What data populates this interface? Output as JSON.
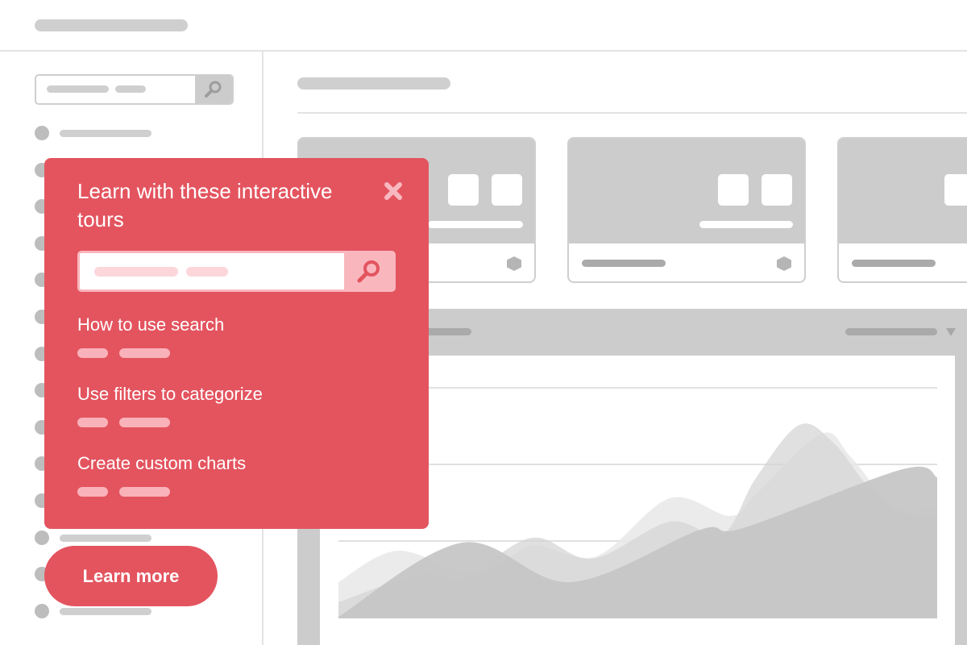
{
  "colors": {
    "accent": "#e3545f",
    "accent_light": "#f9b7bd",
    "placeholder": "#cccccc"
  },
  "popup": {
    "title": "Learn with these interactive tours",
    "close_icon": "close-icon",
    "search_icon": "search-icon",
    "tours": [
      {
        "label": "How to use search"
      },
      {
        "label": "Use filters to categorize"
      },
      {
        "label": "Create custom charts"
      }
    ]
  },
  "learn_more": {
    "label": "Learn more"
  },
  "sidebar": {
    "search_icon": "search-icon"
  },
  "chart_panel": {
    "dropdown_icon": "triangle-down-icon"
  }
}
